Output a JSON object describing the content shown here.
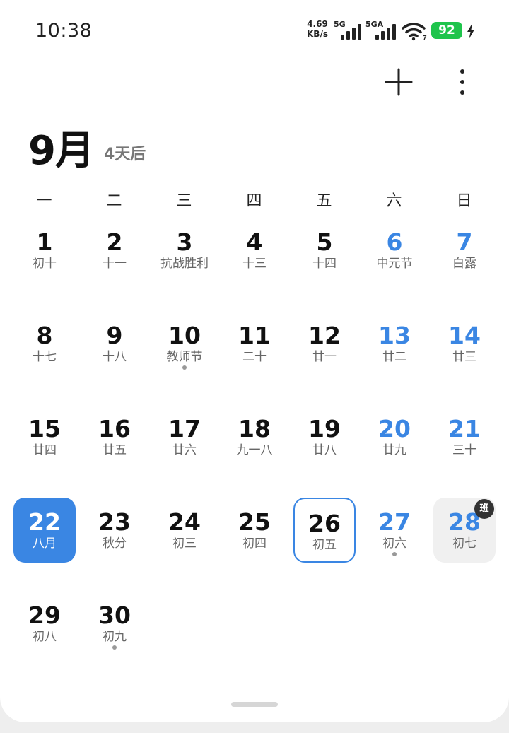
{
  "status": {
    "time": "10:38",
    "speed_value": "4.69",
    "speed_unit": "KB/s",
    "sim1_label": "5G",
    "sim2_label": "5GA",
    "wifi_sub": "7",
    "battery": "92"
  },
  "header": {
    "month": "9月",
    "countdown": "4天后"
  },
  "weekdays": [
    "一",
    "二",
    "三",
    "四",
    "五",
    "六",
    "日"
  ],
  "days": [
    {
      "num": "1",
      "lunar": "初十"
    },
    {
      "num": "2",
      "lunar": "十一"
    },
    {
      "num": "3",
      "lunar": "抗战胜利"
    },
    {
      "num": "4",
      "lunar": "十三"
    },
    {
      "num": "5",
      "lunar": "十四"
    },
    {
      "num": "6",
      "lunar": "中元节"
    },
    {
      "num": "7",
      "lunar": "白露"
    },
    {
      "num": "8",
      "lunar": "十七"
    },
    {
      "num": "9",
      "lunar": "十八"
    },
    {
      "num": "10",
      "lunar": "教师节"
    },
    {
      "num": "11",
      "lunar": "二十"
    },
    {
      "num": "12",
      "lunar": "廿一"
    },
    {
      "num": "13",
      "lunar": "廿二"
    },
    {
      "num": "14",
      "lunar": "廿三"
    },
    {
      "num": "15",
      "lunar": "廿四"
    },
    {
      "num": "16",
      "lunar": "廿五"
    },
    {
      "num": "17",
      "lunar": "廿六"
    },
    {
      "num": "18",
      "lunar": "九一八"
    },
    {
      "num": "19",
      "lunar": "廿八"
    },
    {
      "num": "20",
      "lunar": "廿九"
    },
    {
      "num": "21",
      "lunar": "三十"
    },
    {
      "num": "22",
      "lunar": "八月"
    },
    {
      "num": "23",
      "lunar": "秋分"
    },
    {
      "num": "24",
      "lunar": "初三"
    },
    {
      "num": "25",
      "lunar": "初四"
    },
    {
      "num": "26",
      "lunar": "初五"
    },
    {
      "num": "27",
      "lunar": "初六"
    },
    {
      "num": "28",
      "lunar": "初七"
    },
    {
      "num": "29",
      "lunar": "初八"
    },
    {
      "num": "30",
      "lunar": "初九"
    }
  ],
  "workday_badge": "班",
  "colors": {
    "accent": "#3a86e3",
    "battery": "#1fc44c"
  },
  "icons": [
    "plus-icon",
    "more-vertical-icon",
    "wifi-icon",
    "signal-icon",
    "charging-icon"
  ]
}
